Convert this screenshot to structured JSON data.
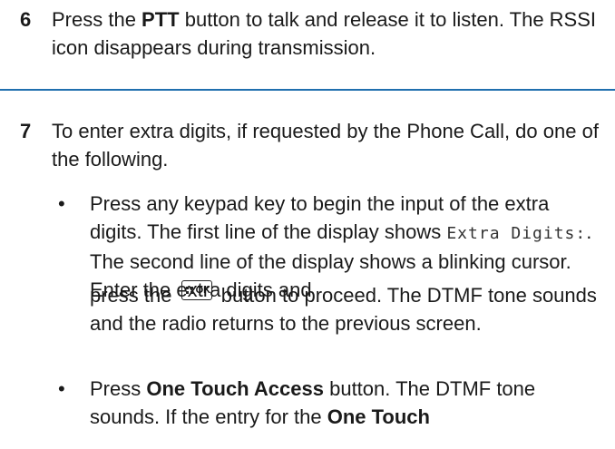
{
  "step6": {
    "number": "6",
    "text_pre": "Press the ",
    "bold_ptt": "PTT",
    "text_post": " button to talk and release it to listen. The RSSI icon disappears during transmission."
  },
  "step7": {
    "number": "7",
    "text": "To enter extra digits, if requested by the Phone Call, do one of the following."
  },
  "bullets": [
    {
      "marker": "•",
      "line_pre": "Press any keypad key to begin the input of the extra digits. The first line of the display shows ",
      "display_text": "Extra Digits:",
      "line_post": ". The second line of the display shows a blinking cursor. Enter the extra digits and"
    },
    {
      "text_pre": "press the ",
      "icon": "menu-ok-key-icon",
      "icon_label": "OK",
      "text_post": " button to proceed. The DTMF tone sounds and the radio returns to the previous screen."
    },
    {
      "marker": "•",
      "text_pre": "Press ",
      "bold1": "One Touch Access",
      "text_mid": " button. The DTMF tone sounds. If the entry for the ",
      "bold2": "One Touch"
    }
  ],
  "colors": {
    "rule": "#1f6fae",
    "text": "#1a1a1a"
  }
}
